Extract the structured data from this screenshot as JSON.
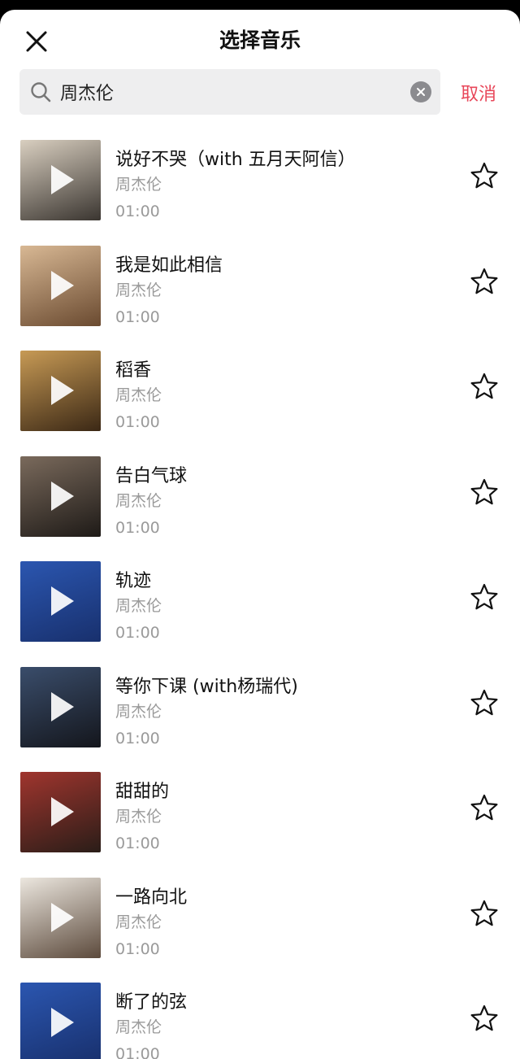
{
  "header": {
    "title": "选择音乐"
  },
  "search": {
    "value": "周杰伦",
    "cancel_label": "取消"
  },
  "songs": [
    {
      "title": "说好不哭（with 五月天阿信）",
      "artist": "周杰伦",
      "duration": "01:00",
      "cover_colors": [
        "#d9cfc0",
        "#3a3530"
      ]
    },
    {
      "title": "我是如此相信",
      "artist": "周杰伦",
      "duration": "01:00",
      "cover_colors": [
        "#d8b894",
        "#6a4a30"
      ]
    },
    {
      "title": "稻香",
      "artist": "周杰伦",
      "duration": "01:00",
      "cover_colors": [
        "#c79a55",
        "#3b2815"
      ]
    },
    {
      "title": "告白气球",
      "artist": "周杰伦",
      "duration": "01:00",
      "cover_colors": [
        "#7a6a5c",
        "#1e1a17"
      ]
    },
    {
      "title": "轨迹",
      "artist": "周杰伦",
      "duration": "01:00",
      "cover_colors": [
        "#2b56b0",
        "#18306d"
      ]
    },
    {
      "title": "等你下课 (with杨瑞代)",
      "artist": "周杰伦",
      "duration": "01:00",
      "cover_colors": [
        "#3a4d6b",
        "#14161c"
      ]
    },
    {
      "title": "甜甜的",
      "artist": "周杰伦",
      "duration": "01:00",
      "cover_colors": [
        "#a0352e",
        "#2a1d18"
      ]
    },
    {
      "title": "一路向北",
      "artist": "周杰伦",
      "duration": "01:00",
      "cover_colors": [
        "#ece7df",
        "#5c4a3c"
      ]
    },
    {
      "title": "断了的弦",
      "artist": "周杰伦",
      "duration": "01:00",
      "cover_colors": [
        "#2b56b0",
        "#18306d"
      ]
    }
  ]
}
